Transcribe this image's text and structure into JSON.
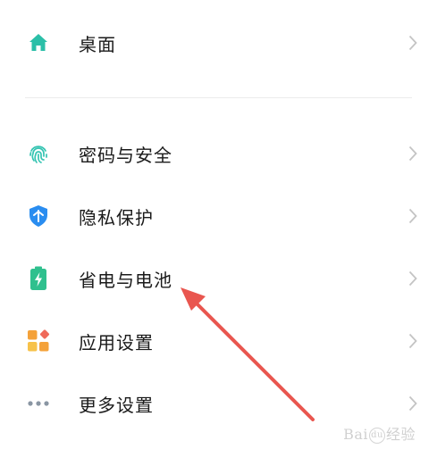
{
  "settings_list": {
    "items": [
      {
        "label": "桌面",
        "icon": "home-icon",
        "icon_color": "#2bbfa8"
      },
      {
        "label": "密码与安全",
        "icon": "fingerprint-icon",
        "icon_color": "#35c4b2"
      },
      {
        "label": "隐私保护",
        "icon": "shield-icon",
        "icon_color": "#2a8df0"
      },
      {
        "label": "省电与电池",
        "icon": "battery-icon",
        "icon_color": "#2fc08e"
      },
      {
        "label": "应用设置",
        "icon": "app-grid-icon",
        "icon_color": "#f4a23a"
      },
      {
        "label": "更多设置",
        "icon": "more-dots-icon",
        "icon_color": "#8a96a3"
      }
    ]
  },
  "annotation": {
    "arrow_color": "#e9564f",
    "points_to": "省电与电池"
  },
  "watermark": {
    "text_before": "Bai",
    "circle": "du",
    "text_after": "经验"
  },
  "colors": {
    "chevron": "#c4c4c4",
    "label": "#1a1a1a",
    "divider": "#ececec"
  }
}
